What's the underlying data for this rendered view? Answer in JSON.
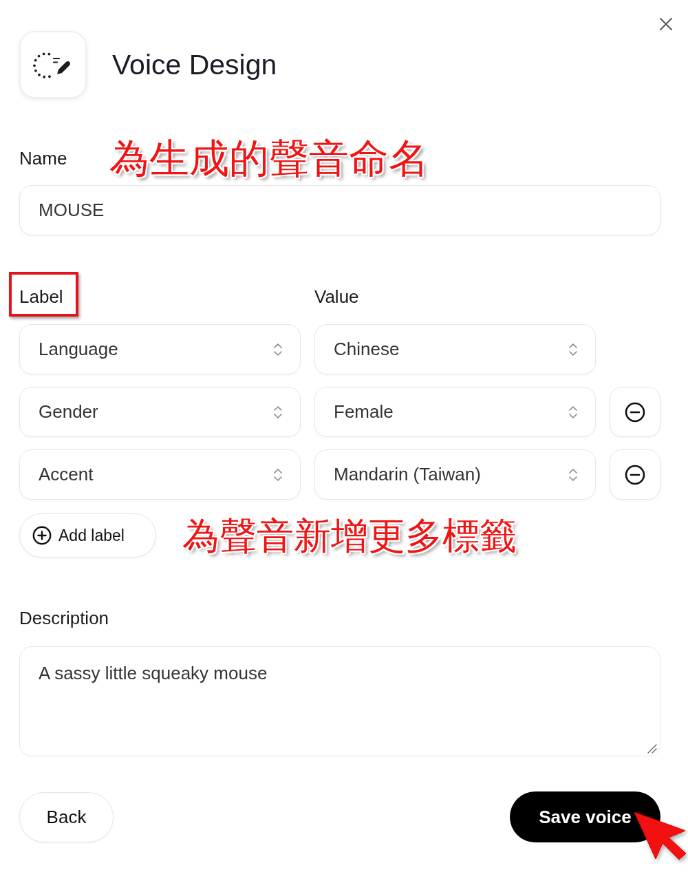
{
  "dialog": {
    "title": "Voice Design"
  },
  "name_field": {
    "label": "Name",
    "value": "MOUSE",
    "annotation": "為生成的聲音命名"
  },
  "label_headers": [
    {
      "text": "Label",
      "highlighted": true
    },
    {
      "text": "Value",
      "highlighted": false
    }
  ],
  "label_rows": [
    {
      "label": "Language",
      "value": "Chinese",
      "removable": false
    },
    {
      "label": "Gender",
      "value": "Female",
      "removable": true
    },
    {
      "label": "Accent",
      "value": "Mandarin (Taiwan)",
      "removable": true
    }
  ],
  "add_label": {
    "label": "Add label",
    "annotation": "為聲音新增更多標籤"
  },
  "description": {
    "label": "Description",
    "value": "A sassy little squeaky mouse"
  },
  "buttons": [
    {
      "label": "Back",
      "kind": "secondary",
      "pointed": false
    },
    {
      "label": "Save voice",
      "kind": "primary",
      "pointed": true
    }
  ]
}
